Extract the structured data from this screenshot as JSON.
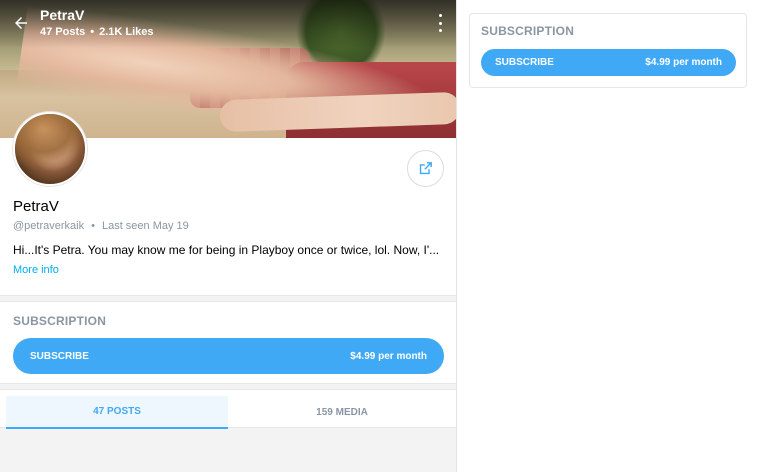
{
  "header": {
    "title": "PetraV",
    "posts": "47 Posts",
    "likes": "2.1K Likes",
    "separator": "•"
  },
  "profile": {
    "name": "PetraV",
    "handle": "@petraverkaik",
    "separator": "•",
    "last_seen": "Last seen May 19",
    "bio": "Hi...It's Petra. You may know me for being in Playboy once or twice, lol. Now, I'...",
    "more_info": "More info"
  },
  "subscription_main": {
    "heading": "SUBSCRIPTION",
    "button_label": "SUBSCRIBE",
    "price": "$4.99 per month"
  },
  "subscription_side": {
    "heading": "SUBSCRIPTION",
    "button_label": "SUBSCRIBE",
    "price": "$4.99 per month"
  },
  "tabs": [
    {
      "label": "47 POSTS",
      "active": true
    },
    {
      "label": "159 MEDIA",
      "active": false
    }
  ],
  "icons": {
    "back": "arrow-left-icon",
    "more": "more-vertical-icon",
    "share": "share-icon"
  },
  "colors": {
    "accent": "#3fa9f5",
    "muted": "#8a96a3",
    "link": "#00aff0"
  }
}
